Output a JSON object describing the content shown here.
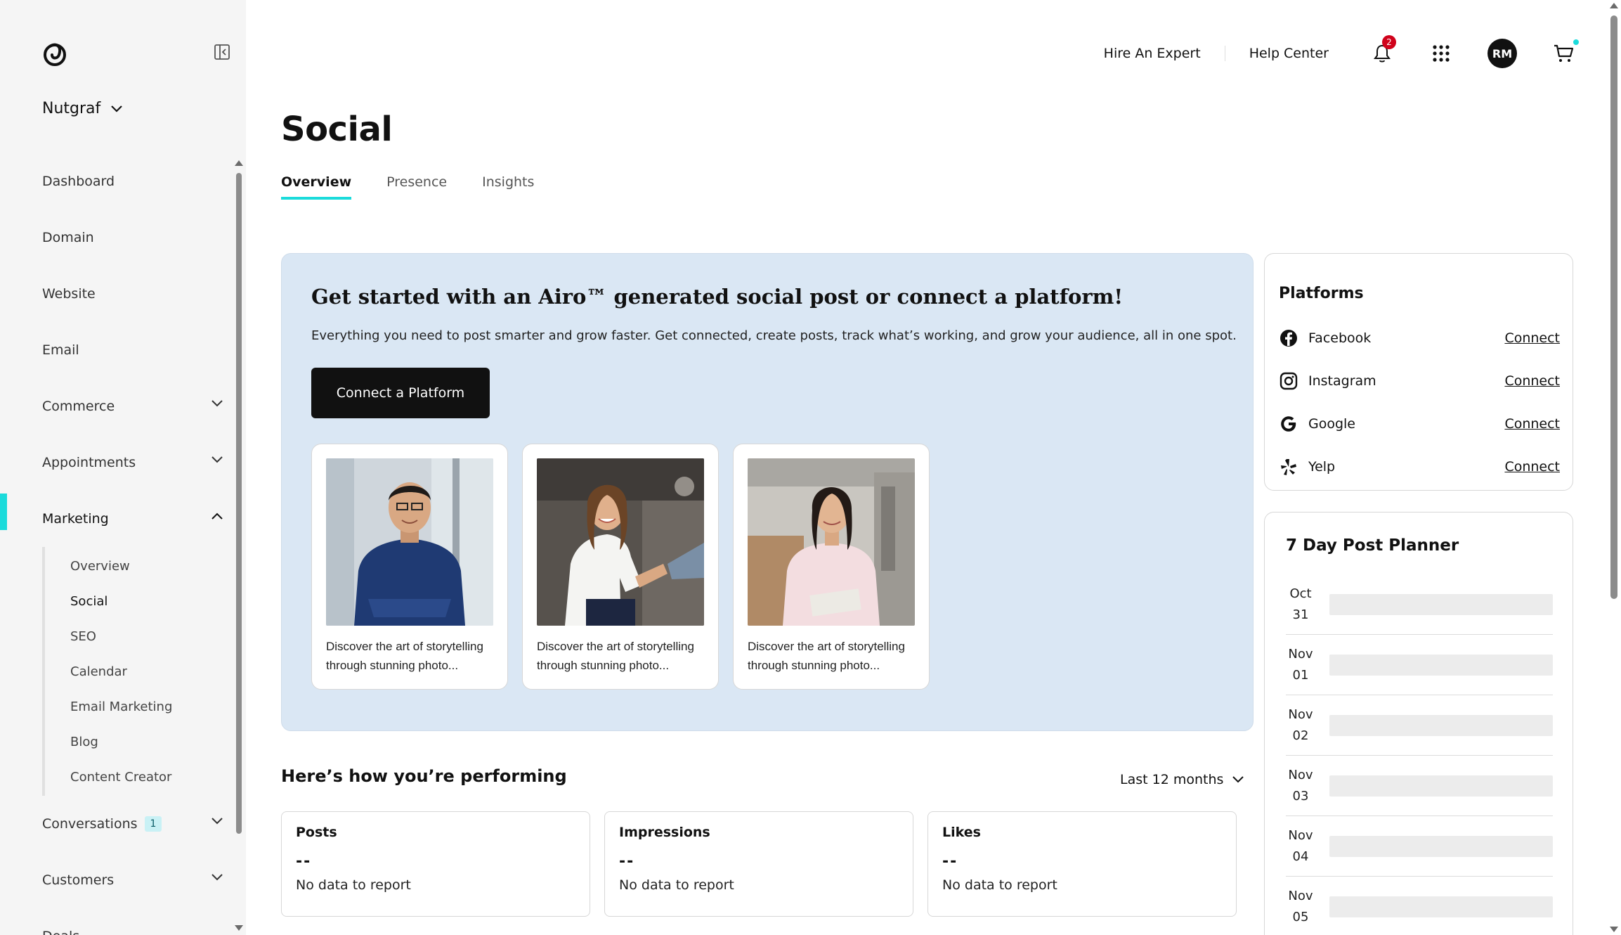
{
  "sidebar": {
    "account_name": "Nutgraf",
    "items": [
      {
        "label": "Dashboard"
      },
      {
        "label": "Domain"
      },
      {
        "label": "Website"
      },
      {
        "label": "Email"
      },
      {
        "label": "Commerce"
      },
      {
        "label": "Appointments"
      },
      {
        "label": "Marketing"
      }
    ],
    "marketing_sub": [
      {
        "label": "Overview"
      },
      {
        "label": "Social"
      },
      {
        "label": "SEO"
      },
      {
        "label": "Calendar"
      },
      {
        "label": "Email Marketing"
      },
      {
        "label": "Blog"
      },
      {
        "label": "Content Creator"
      }
    ],
    "after_items": [
      {
        "label": "Conversations",
        "badge": "1"
      },
      {
        "label": "Customers"
      },
      {
        "label": "Deals"
      }
    ],
    "accent_color": "#1bdbdb"
  },
  "topbar": {
    "hire_label": "Hire An Expert",
    "help_label": "Help Center",
    "notification_count": "2",
    "avatar_initials": "RM"
  },
  "main": {
    "title": "Social",
    "tabs": [
      {
        "label": "Overview"
      },
      {
        "label": "Presence"
      },
      {
        "label": "Insights"
      }
    ]
  },
  "hero": {
    "title": "Get started with an Airo™ generated social post or connect a platform!",
    "subtitle": "Everything you need to post smarter and grow faster. Get connected, create posts, track what’s working, and grow your audience, all in one spot.",
    "button_label": "Connect a Platform",
    "posts": [
      {
        "text": "Discover the art of storytelling through stunning photo..."
      },
      {
        "text": "Discover the art of storytelling through stunning photo..."
      },
      {
        "text": "Discover the art of storytelling through stunning photo..."
      }
    ]
  },
  "performance": {
    "title": "Here’s how you’re performing",
    "range": "Last 12 months",
    "stats": [
      {
        "label": "Posts",
        "value": "--",
        "note": "No data to report"
      },
      {
        "label": "Impressions",
        "value": "--",
        "note": "No data to report"
      },
      {
        "label": "Likes",
        "value": "--",
        "note": "No data to report"
      }
    ]
  },
  "platforms": {
    "title": "Platforms",
    "items": [
      {
        "name": "Facebook",
        "action": "Connect",
        "icon": "facebook-icon"
      },
      {
        "name": "Instagram",
        "action": "Connect",
        "icon": "instagram-icon"
      },
      {
        "name": "Google",
        "action": "Connect",
        "icon": "google-icon"
      },
      {
        "name": "Yelp",
        "action": "Connect",
        "icon": "yelp-icon"
      }
    ]
  },
  "planner": {
    "title": "7 Day Post Planner",
    "days": [
      {
        "month": "Oct",
        "day": "31"
      },
      {
        "month": "Nov",
        "day": "01"
      },
      {
        "month": "Nov",
        "day": "02"
      },
      {
        "month": "Nov",
        "day": "03"
      },
      {
        "month": "Nov",
        "day": "04"
      },
      {
        "month": "Nov",
        "day": "05"
      }
    ]
  }
}
